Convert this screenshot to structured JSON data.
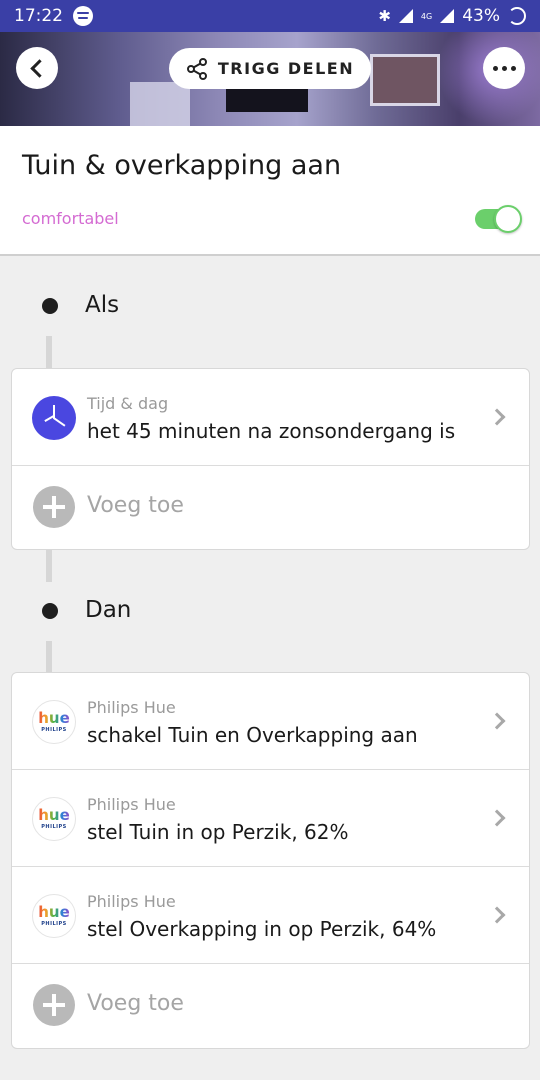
{
  "status_bar": {
    "time": "17:22",
    "battery": "43%",
    "network": "4G"
  },
  "top_bar": {
    "share_label": "TRIGG DELEN"
  },
  "header": {
    "title": "Tuin & overkapping aan",
    "tag": "comfortabel",
    "enabled": true
  },
  "sections": {
    "if": {
      "label": "Als",
      "items": [
        {
          "source": "Tijd & dag",
          "text": "het 45 minuten na zonsondergang is",
          "icon": "clock-icon"
        }
      ],
      "add_label": "Voeg toe"
    },
    "then": {
      "label": "Dan",
      "items": [
        {
          "source": "Philips Hue",
          "text": "schakel Tuin en Overkapping aan",
          "icon": "philips-hue-icon"
        },
        {
          "source": "Philips Hue",
          "text": "stel Tuin in op Perzik, 62%",
          "icon": "philips-hue-icon"
        },
        {
          "source": "Philips Hue",
          "text": "stel Overkapping in op Perzik, 64%",
          "icon": "philips-hue-icon"
        }
      ],
      "add_label": "Voeg toe"
    }
  },
  "hue_logo": {
    "word": "hue",
    "brand": "PHILIPS"
  },
  "colors": {
    "status_bar": "#3a3fa6",
    "tag": "#d46bd2",
    "toggle_on": "#6bcf6b",
    "clock": "#4a47e0"
  }
}
